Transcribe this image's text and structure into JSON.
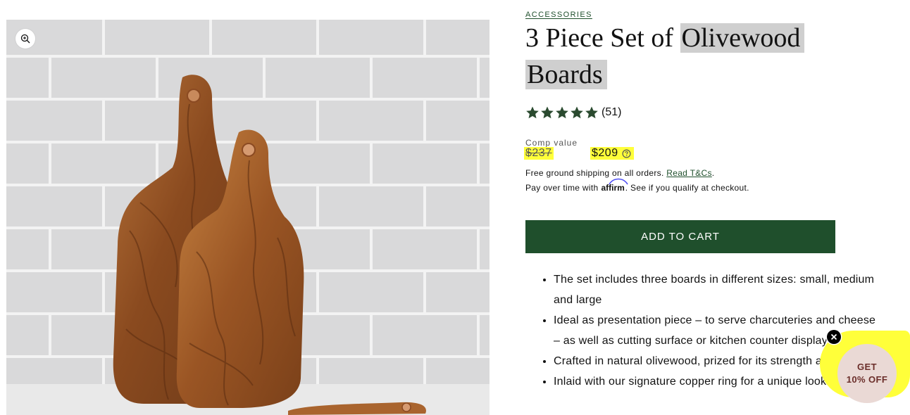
{
  "product": {
    "vendor": "ACCESSORIES",
    "title_part1": "3 Piece Set of ",
    "title_part2": "Olivewood",
    "title_part3": "Boards",
    "rating_stars": 5,
    "rating_count": "(51)",
    "comp_label": "Comp value",
    "price_old": "$237",
    "price_new": "$209",
    "shipping_text": "Free ground shipping on all orders.",
    "shipping_link": "Read T&Cs",
    "shipping_end": ".",
    "paylater_prefix": "Pay over time with",
    "affirm_brand": "affirm",
    "paylater_suffix": ". See if you qualify at checkout.",
    "add_to_cart": "ADD TO CART",
    "features": [
      "The set includes three boards in different sizes: small, medium and large",
      "Ideal as presentation piece – to serve charcuteries and cheese – as well as cutting surface or kitchen counter display",
      "Crafted in natural olivewood, prized for its strength and beauty",
      "Inlaid with our signature copper ring for a unique look and"
    ]
  },
  "popup": {
    "line1": "GET",
    "line2": "10% OFF"
  },
  "colors": {
    "accent_green": "#1f4f2c",
    "highlight_yellow": "#ffff3a",
    "promo_bg": "#ead9d5",
    "promo_text": "#6b2e2a"
  },
  "icons": {
    "zoom": "magnifier-plus-icon",
    "star": "star-icon",
    "help": "question-circle-icon",
    "close": "close-x-icon"
  }
}
